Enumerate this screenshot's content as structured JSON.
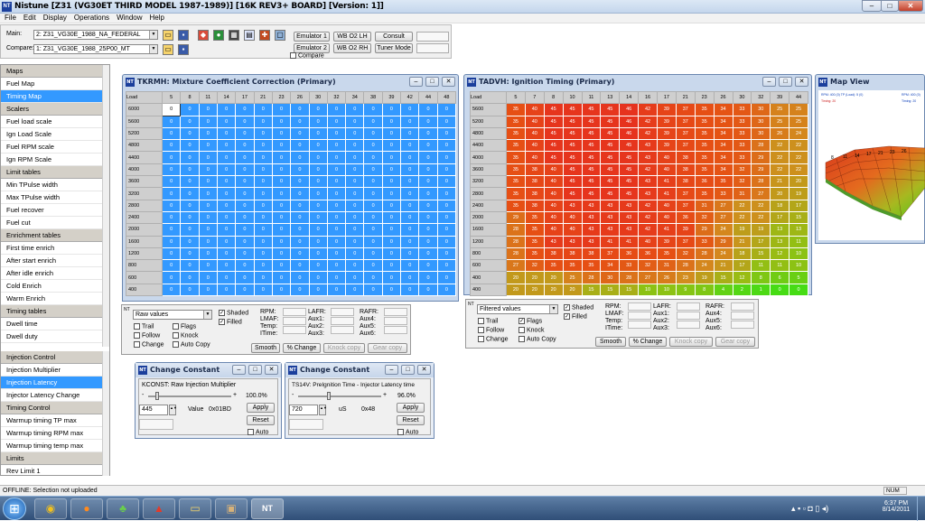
{
  "app": {
    "title": "Nistune [Z31 (VG30ET THIRD MODEL 1987-1989)] [16K REV3+ BOARD] [Version: 1]]",
    "icon_text": "NT"
  },
  "menu": [
    "File",
    "Edit",
    "Display",
    "Operations",
    "Window",
    "Help"
  ],
  "toolbar": {
    "main_label": "Main:",
    "main_value": "2: Z31_VG30E_1988_NA_FEDERAL",
    "compare_label": "Compare:",
    "compare_value": "1: Z31_VG30E_1988_25P00_MT",
    "emulator1": "Emulator 1",
    "emulator2": "Emulator 2",
    "wbo2lh": "WB O2 LH",
    "wbo2rh": "WB O2 RH",
    "consult": "Consult",
    "tuner_mode": "Tuner Mode",
    "compare_check": "Compare"
  },
  "sidebar": {
    "groups": [
      {
        "title": "Maps",
        "items": [
          "Fuel Map",
          "Timing Map"
        ]
      },
      {
        "title": "Scalers",
        "items": [
          "Fuel load scale",
          "Ign Load Scale",
          "Fuel RPM scale",
          "Ign RPM Scale"
        ]
      },
      {
        "title": "Limit tables",
        "items": [
          "Min TPulse width",
          "Max TPulse width",
          "Fuel recover",
          "Fuel cut"
        ]
      },
      {
        "title": "Enrichment tables",
        "items": [
          "First time enrich",
          "After start enrich",
          "After idle enrich",
          "Cold Enrich",
          "Warm Enrich"
        ]
      },
      {
        "title": "Timing tables",
        "items": [
          "Dwell time",
          "Dwell duty"
        ]
      }
    ],
    "selected": "Timing Map",
    "groups2": [
      {
        "title": "Injection Control",
        "items": [
          "Injection Multiplier",
          "Injection Latency",
          "Injector Latency Change"
        ]
      },
      {
        "title": "Timing Control",
        "items": [
          "Warmup timing TP max",
          "Warmup timing RPM max",
          "Warmup timing temp max"
        ]
      },
      {
        "title": "Limits",
        "items": [
          "Rev Limit 1"
        ]
      }
    ],
    "selected2": "Injection Latency"
  },
  "fuel_window": {
    "title": "TKRMH: Mixture Coefficient Correction (Primary)",
    "corner": "Load",
    "cols": [
      "5",
      "8",
      "11",
      "14",
      "17",
      "21",
      "23",
      "26",
      "30",
      "32",
      "34",
      "38",
      "39",
      "42",
      "44",
      "48"
    ],
    "rows": [
      "6000",
      "5600",
      "5200",
      "4800",
      "4400",
      "4000",
      "3600",
      "3200",
      "2800",
      "2400",
      "2000",
      "1600",
      "1200",
      "800",
      "600",
      "400"
    ],
    "cell_value": "0",
    "cell_color": "#3399ff"
  },
  "timing_window": {
    "title": "TADVH: Ignition Timing (Primary)",
    "corner": "Load",
    "cols": [
      "5",
      "7",
      "8",
      "10",
      "11",
      "13",
      "14",
      "16",
      "17",
      "21",
      "23",
      "26",
      "30",
      "32",
      "39",
      "44"
    ],
    "rows": [
      {
        "rpm": "5600",
        "vals": [
          35,
          40,
          45,
          45,
          45,
          45,
          46,
          42,
          39,
          37,
          35,
          34,
          33,
          30,
          25,
          25
        ]
      },
      {
        "rpm": "5200",
        "vals": [
          35,
          40,
          45,
          45,
          45,
          45,
          46,
          42,
          39,
          37,
          35,
          34,
          33,
          30,
          25,
          25
        ]
      },
      {
        "rpm": "4800",
        "vals": [
          35,
          40,
          45,
          45,
          45,
          45,
          46,
          42,
          39,
          37,
          35,
          34,
          33,
          30,
          26,
          24
        ]
      },
      {
        "rpm": "4400",
        "vals": [
          35,
          40,
          45,
          45,
          45,
          45,
          45,
          43,
          39,
          37,
          35,
          34,
          33,
          28,
          22,
          22
        ]
      },
      {
        "rpm": "4000",
        "vals": [
          35,
          40,
          45,
          45,
          45,
          45,
          45,
          43,
          40,
          38,
          35,
          34,
          33,
          29,
          22,
          22
        ]
      },
      {
        "rpm": "3600",
        "vals": [
          35,
          38,
          40,
          45,
          45,
          45,
          45,
          42,
          40,
          38,
          35,
          34,
          32,
          29,
          22,
          22
        ]
      },
      {
        "rpm": "3200",
        "vals": [
          35,
          38,
          40,
          45,
          45,
          45,
          45,
          43,
          41,
          38,
          36,
          35,
          32,
          28,
          21,
          20
        ]
      },
      {
        "rpm": "2800",
        "vals": [
          35,
          38,
          40,
          45,
          45,
          45,
          45,
          43,
          41,
          37,
          35,
          33,
          31,
          27,
          20,
          19
        ]
      },
      {
        "rpm": "2400",
        "vals": [
          35,
          38,
          40,
          43,
          43,
          43,
          43,
          42,
          40,
          37,
          31,
          27,
          22,
          22,
          18,
          17
        ]
      },
      {
        "rpm": "2000",
        "vals": [
          29,
          35,
          40,
          40,
          43,
          43,
          43,
          42,
          40,
          36,
          32,
          27,
          22,
          22,
          17,
          15
        ]
      },
      {
        "rpm": "1600",
        "vals": [
          28,
          35,
          40,
          40,
          43,
          43,
          43,
          42,
          41,
          39,
          29,
          24,
          19,
          19,
          13,
          13
        ]
      },
      {
        "rpm": "1200",
        "vals": [
          28,
          35,
          43,
          43,
          43,
          41,
          41,
          40,
          39,
          37,
          33,
          29,
          21,
          17,
          13,
          11
        ]
      },
      {
        "rpm": "800",
        "vals": [
          28,
          35,
          38,
          38,
          38,
          37,
          36,
          36,
          35,
          32,
          28,
          24,
          18,
          15,
          12,
          10
        ]
      },
      {
        "rpm": "600",
        "vals": [
          27,
          32,
          35,
          35,
          35,
          34,
          33,
          32,
          31,
          28,
          24,
          21,
          17,
          11,
          11,
          10
        ]
      },
      {
        "rpm": "400",
        "vals": [
          20,
          20,
          20,
          25,
          28,
          30,
          28,
          27,
          26,
          23,
          19,
          15,
          12,
          8,
          6,
          5
        ]
      },
      {
        "rpm": "400b",
        "vals": [
          20,
          20,
          20,
          20,
          15,
          15,
          15,
          10,
          10,
          9,
          8,
          4,
          2,
          1,
          0,
          0
        ]
      }
    ]
  },
  "fuel_panel": {
    "view": "Raw values",
    "trail": "Trail",
    "follow": "Follow",
    "change": "Change",
    "flags": "Flags",
    "knock": "Knock",
    "auto_copy": "Auto Copy",
    "shaded": "Shaded",
    "filled": "Filled",
    "rpm": "RPM:",
    "lmaf": "LMAF:",
    "temp": "Temp:",
    "itime": "ITime:",
    "lafr": "LAFR:",
    "aux1": "Aux1:",
    "aux2": "Aux2:",
    "aux3": "Aux3:",
    "rafr": "RAFR:",
    "aux4": "Aux4:",
    "aux5": "Aux5:",
    "aux6": "Aux6:",
    "smooth": "Smooth",
    "pchange": "% Change",
    "knock_copy": "Knock copy",
    "gear_copy": "Gear copy"
  },
  "timing_panel": {
    "view": "Filtered values"
  },
  "map_view": {
    "title": "Map View",
    "legend_left": "RPM: 400 (0) TP (Load): 5 (0)",
    "legend_left2": "Timing: 20",
    "legend_right": "RPM: 400 (0)",
    "legend_right2": "Timing: 20",
    "axis_labels": [
      "8",
      "11",
      "14",
      "17",
      "21",
      "23",
      "26"
    ]
  },
  "cc1": {
    "title": "Change Constant",
    "desc": "KCONST: Raw Injection Multiplier",
    "pct": "100.0%",
    "value": "445",
    "value_label": "Value",
    "hex": "0x01BD",
    "apply": "Apply",
    "reset": "Reset",
    "auto": "Auto"
  },
  "cc2": {
    "title": "Change Constant",
    "desc": "TS14V: PreIgnition Time - Injector Latency time",
    "pct": "96.0%",
    "value": "720",
    "unit": "uS",
    "hex": "0x48",
    "apply": "Apply",
    "reset": "Reset",
    "auto": "Auto"
  },
  "status": {
    "text": "OFFLINE: Selection not uploaded",
    "num": "NUM"
  },
  "taskbar": {
    "time": "6:37 PM",
    "date": "8/14/2011"
  }
}
